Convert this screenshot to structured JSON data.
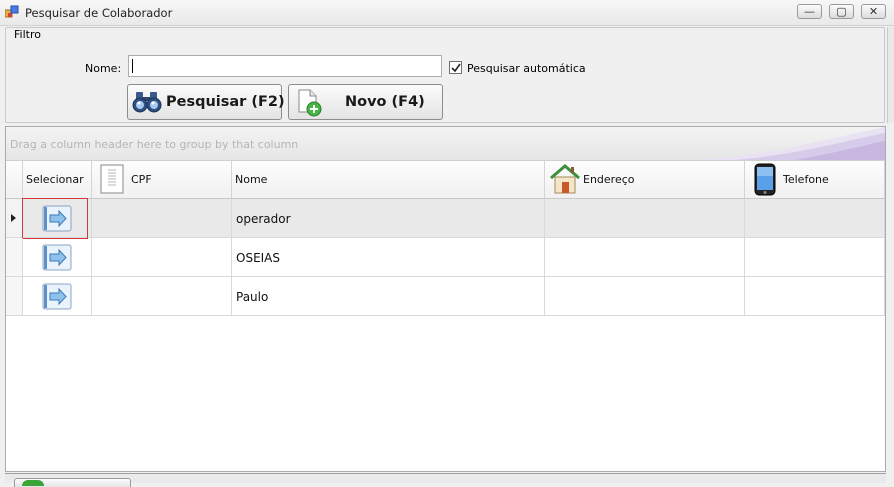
{
  "window": {
    "title": "Pesquisar de Colaborador",
    "buttons": {
      "minimize": "—",
      "maximize": "▢",
      "close": "✕"
    }
  },
  "filter": {
    "legend": "Filtro",
    "name_label": "Nome:",
    "name_value": "",
    "auto_search_label": "Pesquisar automática",
    "auto_search_checked": true,
    "search_button": "Pesquisar (F2)",
    "new_button": "Novo (F4)"
  },
  "grid": {
    "group_panel_text": "Drag a column header here to group by that column",
    "columns": [
      {
        "label": "Selecionar",
        "icon": ""
      },
      {
        "label": "CPF",
        "icon": "document-icon"
      },
      {
        "label": "Nome",
        "icon": ""
      },
      {
        "label": "Endereço",
        "icon": "house-icon"
      },
      {
        "label": "Telefone",
        "icon": "mobile-phone-icon"
      }
    ],
    "rows": [
      {
        "cpf": "",
        "nome": "operador",
        "endereco": "",
        "telefone": "",
        "current": true
      },
      {
        "cpf": "",
        "nome": "OSEIAS",
        "endereco": "",
        "telefone": ""
      },
      {
        "cpf": "",
        "nome": "Paulo",
        "endereco": "",
        "telefone": ""
      }
    ],
    "select_icon": "arrow-right-icon"
  },
  "colors": {
    "focus_border": "#d23a3a",
    "accent_green": "#3aa43a",
    "swoosh": "#b9a6d9"
  }
}
